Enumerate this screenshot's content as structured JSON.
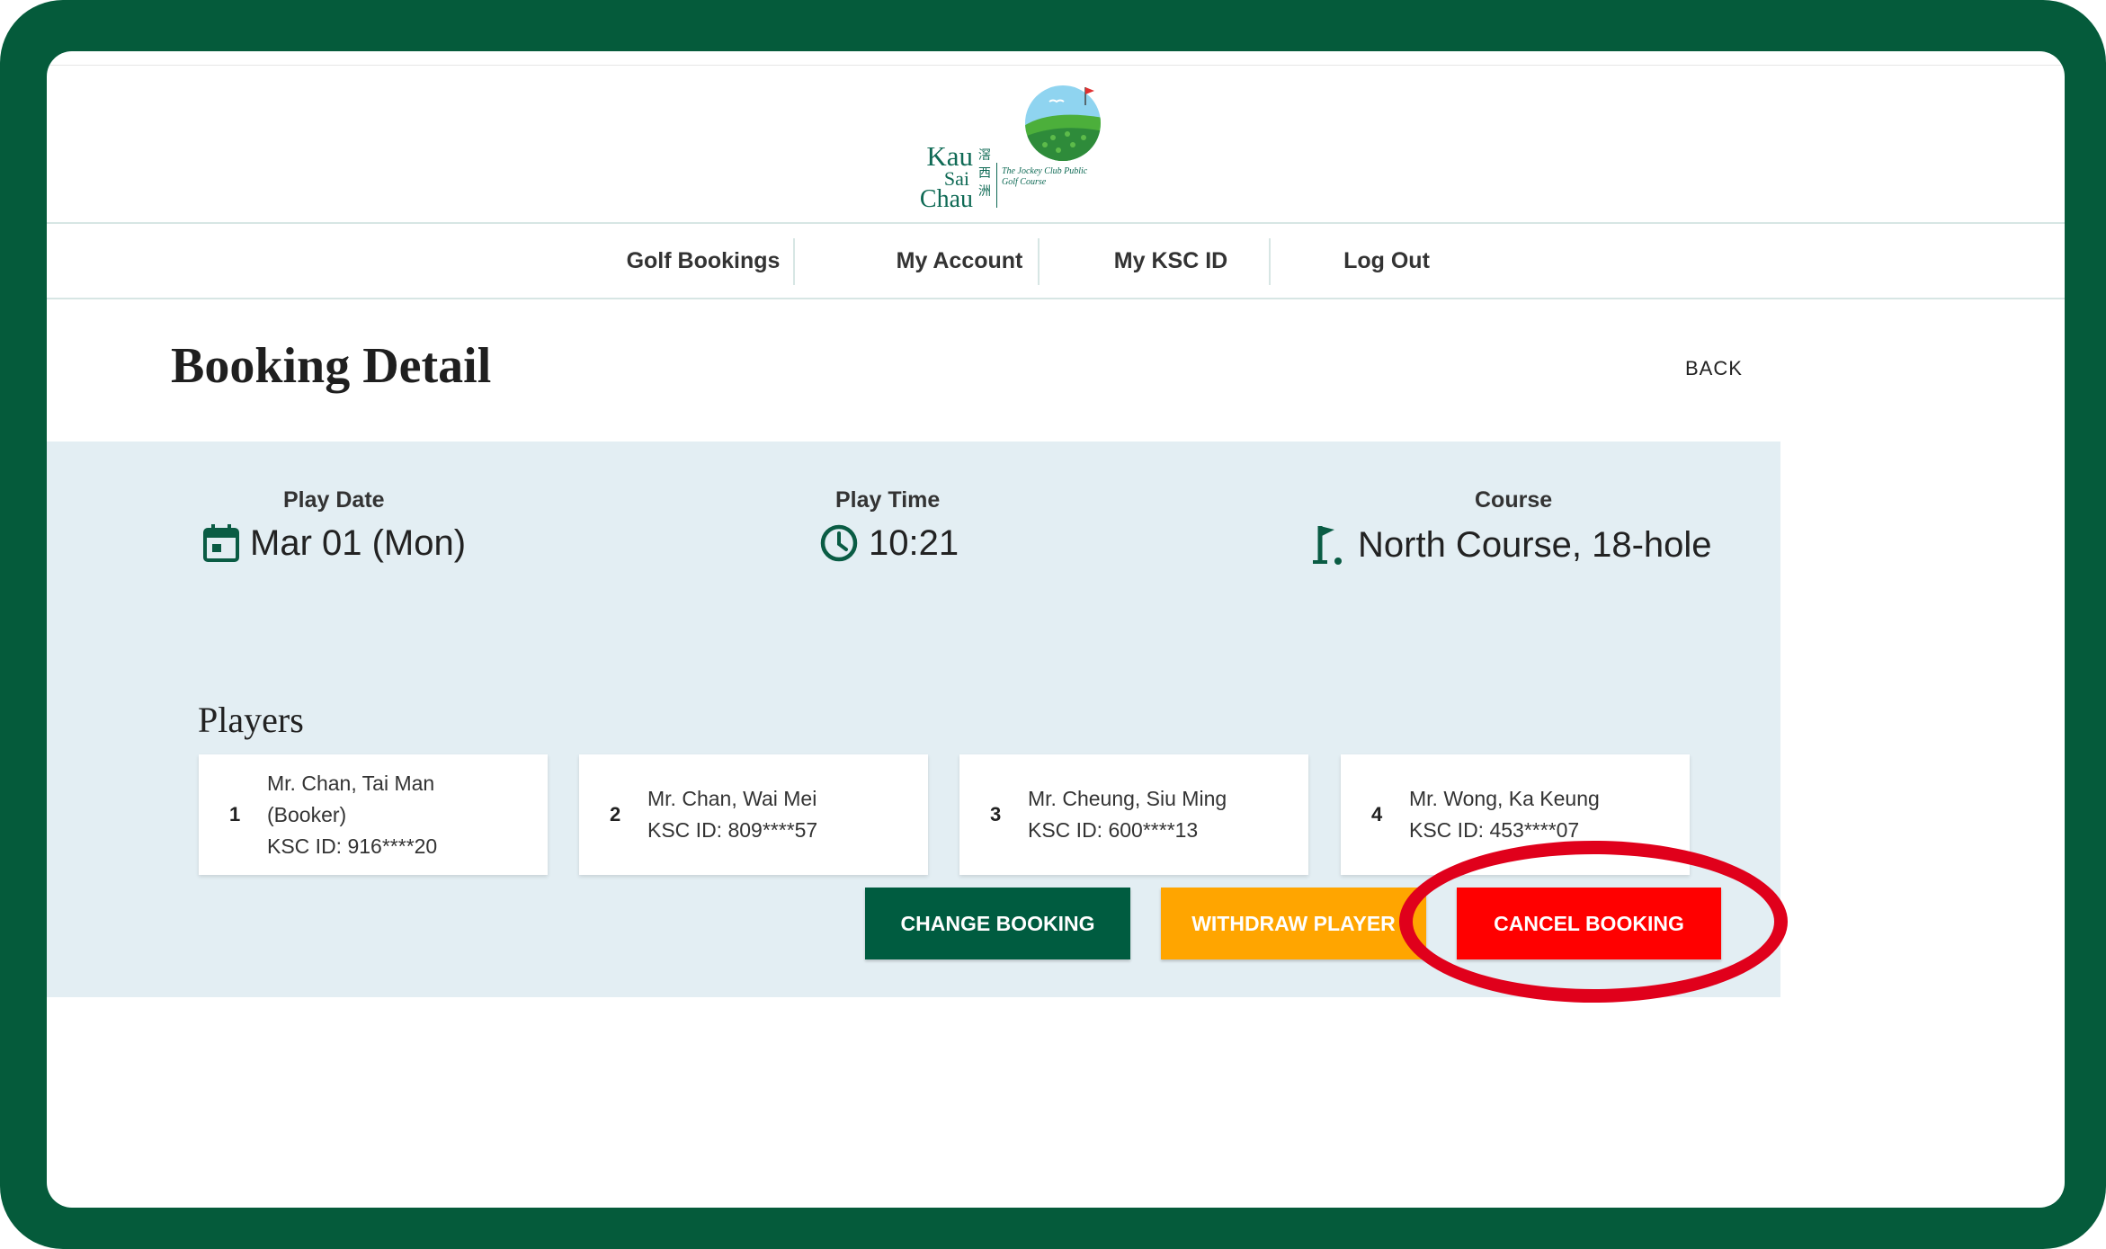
{
  "logo": {
    "name_line1": "Kau",
    "name_line2": "Sai",
    "name_line3": "Chau",
    "name_cn": "滘西洲",
    "subtitle": "The Jockey Club Public Golf Course"
  },
  "nav": {
    "items": [
      {
        "label": "Golf Bookings"
      },
      {
        "label": "My Account"
      },
      {
        "label": "My KSC ID"
      },
      {
        "label": "Log Out"
      }
    ]
  },
  "page": {
    "title": "Booking Detail",
    "back_label": "BACK"
  },
  "booking": {
    "play_date_label": "Play Date",
    "play_date": "Mar 01 (Mon)",
    "play_time_label": "Play Time",
    "play_time": "10:21",
    "course_label": "Course",
    "course": "North Course, 18-hole"
  },
  "players": {
    "title": "Players",
    "list": [
      {
        "num": "1",
        "line1": "Mr. Chan, Tai Man",
        "line2": "(Booker)",
        "line3": "KSC ID: 916****20"
      },
      {
        "num": "2",
        "line1": "Mr. Chan, Wai Mei",
        "line2": "KSC ID: 809****57"
      },
      {
        "num": "3",
        "line1": "Mr. Cheung, Siu Ming",
        "line2": "KSC ID: 600****13"
      },
      {
        "num": "4",
        "line1": "Mr. Wong, Ka Keung",
        "line2": "KSC ID: 453****07"
      }
    ]
  },
  "actions": {
    "change": "CHANGE BOOKING",
    "withdraw": "WITHDRAW PLAYER",
    "cancel": "CANCEL BOOKING"
  },
  "colors": {
    "frame": "#055b3b",
    "panel": "#e3eef3",
    "change_button": "#005c40",
    "withdraw_button": "#ffa500",
    "cancel_button": "#ff0000",
    "highlight_ring": "#e0001b"
  }
}
